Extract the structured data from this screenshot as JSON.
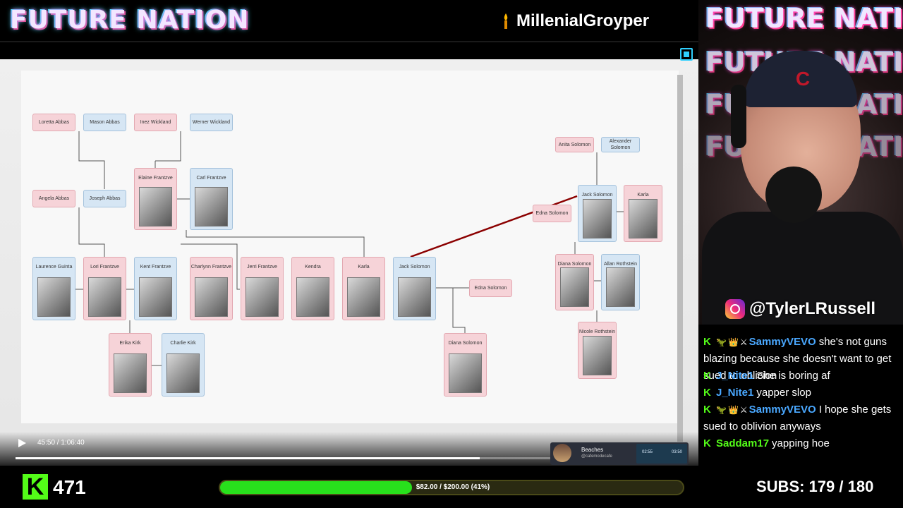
{
  "banner": {
    "logo": "FUTURE NATION",
    "streamer_name": "MillenialGroyper",
    "streamer_icon": "candle-icon"
  },
  "tree": {
    "nodes": [
      {
        "id": "loretta",
        "label": "Loretta Abbas",
        "gender": "f",
        "photo": false
      },
      {
        "id": "mason",
        "label": "Mason Abbas",
        "gender": "m",
        "photo": false
      },
      {
        "id": "inez",
        "label": "Inez Wickland",
        "gender": "f",
        "photo": false
      },
      {
        "id": "werner",
        "label": "Werner Wickland",
        "gender": "m",
        "photo": false
      },
      {
        "id": "angela",
        "label": "Angela Abbas",
        "gender": "f",
        "photo": false
      },
      {
        "id": "joseph",
        "label": "Joseph Abbas",
        "gender": "m",
        "photo": false
      },
      {
        "id": "elaine",
        "label": "Elaine Frantzve",
        "gender": "f",
        "photo": true
      },
      {
        "id": "carl",
        "label": "Carl Frantzve",
        "gender": "m",
        "photo": true
      },
      {
        "id": "laurence",
        "label": "Laurence Guinta",
        "gender": "m",
        "photo": true
      },
      {
        "id": "lori",
        "label": "Lori Frantzve",
        "gender": "f",
        "photo": true
      },
      {
        "id": "kent",
        "label": "Kent Frantzve",
        "gender": "m",
        "photo": true
      },
      {
        "id": "charlynn",
        "label": "Charlynn Frantzve",
        "gender": "f",
        "photo": true
      },
      {
        "id": "jerri",
        "label": "Jerri Frantzve",
        "gender": "f",
        "photo": true
      },
      {
        "id": "kendra",
        "label": "Kendra",
        "gender": "f",
        "photo": true
      },
      {
        "id": "karla",
        "label": "Karla",
        "gender": "f",
        "photo": true
      },
      {
        "id": "jack",
        "label": "Jack Solomon",
        "gender": "m",
        "photo": true
      },
      {
        "id": "edna1",
        "label": "Edna Solomon",
        "gender": "f",
        "photo": false
      },
      {
        "id": "erika",
        "label": "Erika Kirk",
        "gender": "f",
        "photo": true
      },
      {
        "id": "charlie",
        "label": "Charlie Kirk",
        "gender": "m",
        "photo": true
      },
      {
        "id": "diana1",
        "label": "Diana Solomon",
        "gender": "f",
        "photo": true
      },
      {
        "id": "anita",
        "label": "Anita Solomon",
        "gender": "f",
        "photo": false
      },
      {
        "id": "alexander",
        "label": "Alexander Solomon",
        "gender": "m",
        "photo": false
      },
      {
        "id": "jack2",
        "label": "Jack Solomon",
        "gender": "m",
        "photo": true
      },
      {
        "id": "karla2",
        "label": "Karla",
        "gender": "f",
        "photo": true
      },
      {
        "id": "edna2",
        "label": "Edna Solomon",
        "gender": "f",
        "photo": false
      },
      {
        "id": "diana2",
        "label": "Diana Solomon",
        "gender": "f",
        "photo": true
      },
      {
        "id": "allan",
        "label": "Allan Rothstein",
        "gender": "m",
        "photo": true
      },
      {
        "id": "nicole",
        "label": "Nicole Rothstein",
        "gender": "f",
        "photo": true
      }
    ]
  },
  "player": {
    "time": "45:50 / 1:06:40",
    "progress": 0.69,
    "mini_title": "Beaches",
    "mini_sub": "@cafemodecafe",
    "mini_t1": "02:55",
    "mini_t2": "03:50"
  },
  "cam": {
    "titles": [
      "FUTURE NATION",
      "FUTURE NATION",
      "FUTURE NATION",
      "FUTURE NATION"
    ],
    "cap_logo": "C",
    "instagram": "@TylerLRussell"
  },
  "chat": [
    {
      "user": "SammyVEVO",
      "color": "#4aa8ff",
      "badges": [
        "🦖",
        "👑",
        "⚔"
      ],
      "text": "she's not guns blazing because she doesn't want to get sued to oblicion"
    },
    {
      "user": "J_Nite1",
      "color": "#4aa8ff",
      "badges": [],
      "text": "She is boring af"
    },
    {
      "user": "J_Nite1",
      "color": "#4aa8ff",
      "badges": [],
      "text": "yapper slop"
    },
    {
      "user": "SammyVEVO",
      "color": "#4aa8ff",
      "badges": [
        "🦖",
        "👑",
        "⚔"
      ],
      "text": "I hope she gets sued to oblivion anyways"
    },
    {
      "user": "Saddam17",
      "color": "#53fc18",
      "badges": [],
      "text": "yapping hoe"
    }
  ],
  "bottom": {
    "kick_letter": "K",
    "viewers": "471",
    "goal_text": "$82.00 / $200.00 (41%)",
    "goal_fraction": 0.41,
    "subs": "SUBS:  179 / 180"
  },
  "colors": {
    "kick_green": "#53fc18",
    "female_node": "#f6d3d8",
    "male_node": "#d6e6f4",
    "highlight_line": "#8b0000"
  }
}
